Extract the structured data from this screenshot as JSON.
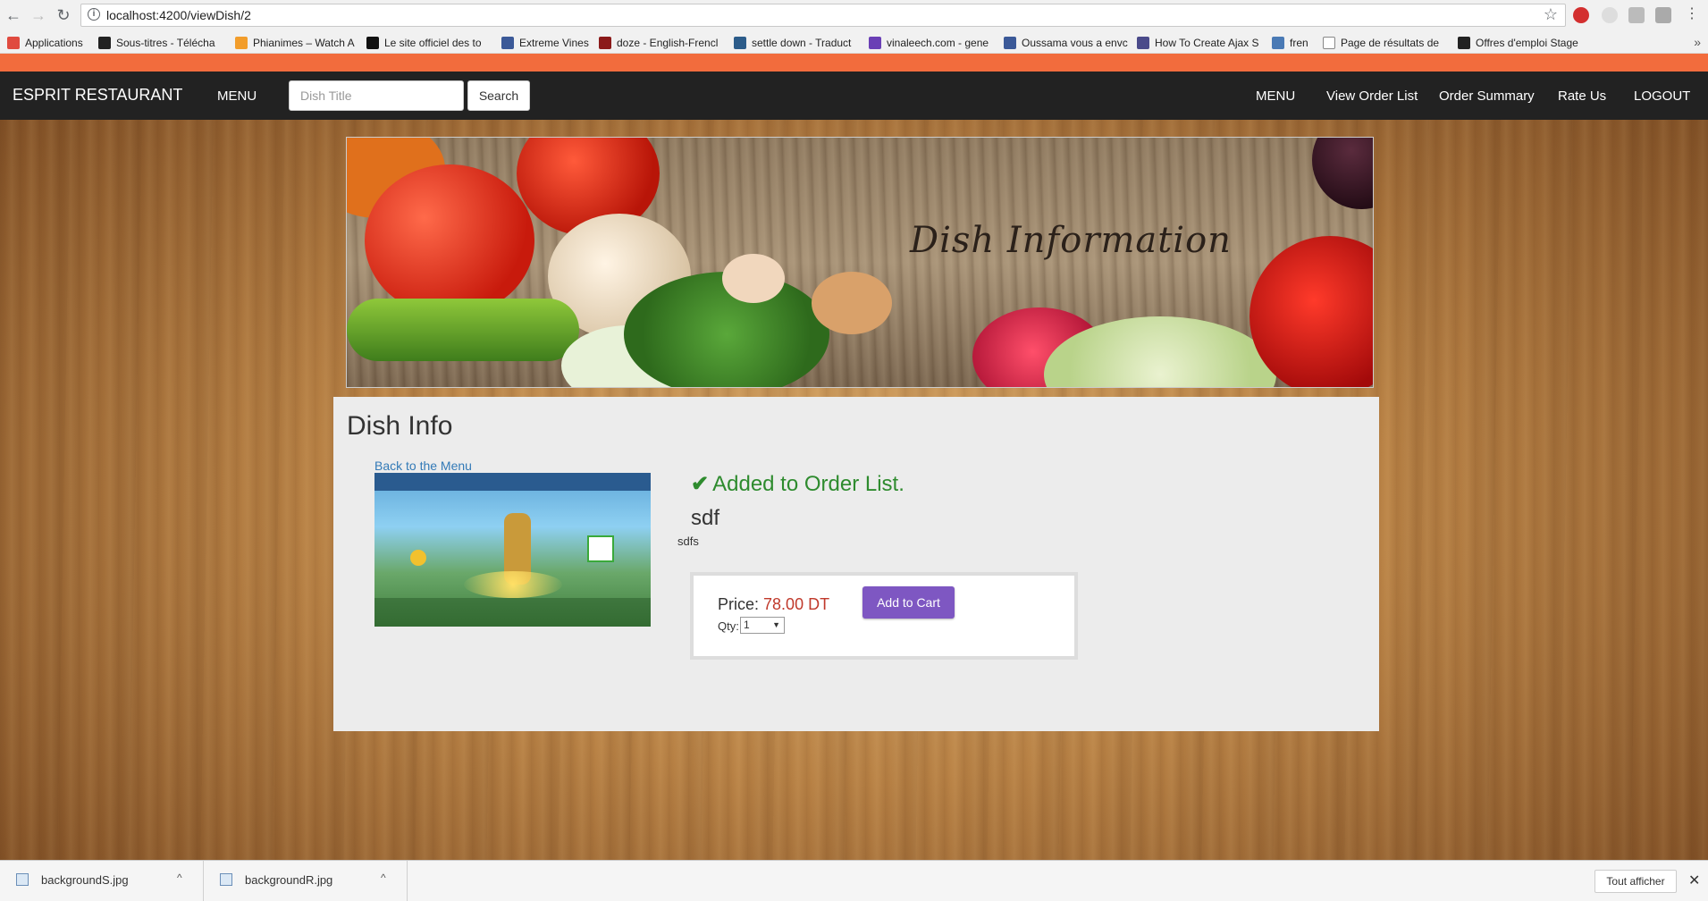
{
  "browser": {
    "url": "localhost:4200/viewDish/2",
    "bookmarks": [
      {
        "label": "Applications",
        "icon": "apps-grid-icon",
        "color": "#e04a3f"
      },
      {
        "label": "Sous-titres - Télécha",
        "icon": "os-favicon-icon",
        "color": "#222222"
      },
      {
        "label": "Phianimes – Watch A",
        "icon": "go-favicon-icon",
        "color": "#f29d2b"
      },
      {
        "label": "Le site officiel des to",
        "icon": "y-favicon-icon",
        "color": "#111111"
      },
      {
        "label": "Extreme Vines",
        "icon": "facebook-icon",
        "color": "#3b5998"
      },
      {
        "label": "doze - English-Frencl",
        "icon": "wr-favicon-icon",
        "color": "#8b1a1a"
      },
      {
        "label": "settle down - Traduct",
        "icon": "translate-favicon-icon",
        "color": "#2c5c8a"
      },
      {
        "label": "vinaleech.com - gene",
        "icon": "vinaleech-favicon-icon",
        "color": "#6a3fb5"
      },
      {
        "label": "Oussama vous a envc",
        "icon": "facebook-icon",
        "color": "#3b5998"
      },
      {
        "label": "How To Create Ajax S",
        "icon": "bus-favicon-icon",
        "color": "#4a4a8a"
      },
      {
        "label": "fren",
        "icon": "fren-favicon-icon",
        "color": "#4a7ab5"
      },
      {
        "label": "Page de résultats de",
        "icon": "page-icon",
        "color": "#888888"
      },
      {
        "label": "Offres d'emploi Stage",
        "icon": "oc-favicon-icon",
        "color": "#222222"
      }
    ]
  },
  "header": {
    "brand": "ESPRIT RESTAURANT",
    "menu_left": "MENU",
    "search_placeholder": "Dish Title",
    "search_button": "Search",
    "nav_right": [
      "MENU",
      "View Order List",
      "Order Summary",
      "Rate Us",
      "LOGOUT"
    ],
    "accent_color": "#f26c3d"
  },
  "banner": {
    "title": "Dish Information"
  },
  "dish": {
    "page_title": "Dish Info",
    "back_link": "Back to the Menu",
    "success_message": "Added to Order List.",
    "name": "sdf",
    "description": "sdfs",
    "price_label": "Price:",
    "price_value": "78.00 DT",
    "add_to_cart": "Add to Cart",
    "qty_label": "Qty:",
    "qty_selected": "1"
  },
  "downloads": {
    "items": [
      "backgroundS.jpg",
      "backgroundR.jpg"
    ],
    "show_all": "Tout afficher"
  }
}
